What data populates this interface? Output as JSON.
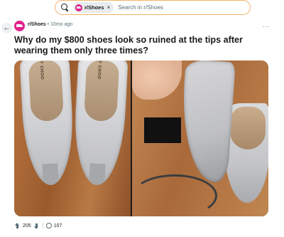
{
  "search": {
    "community_chip": "r/Shoes",
    "chip_close": "×",
    "placeholder": "Search in r/Shoes"
  },
  "post": {
    "subreddit": "r/Shoes",
    "separator": " • ",
    "age": "10mo ago",
    "more": "···",
    "title": "Why do my $800 shoes look so ruined at the tips after wearing them only three times?",
    "images": {
      "left_brand_a": "JIMMY CHOO",
      "left_brand_b": "JIMMY CHOO"
    },
    "votes": "205",
    "comments": "107"
  },
  "colors": {
    "search_border": "#f4b266",
    "subreddit_avatar": "#e0218a",
    "meta_text": "#576f76"
  }
}
